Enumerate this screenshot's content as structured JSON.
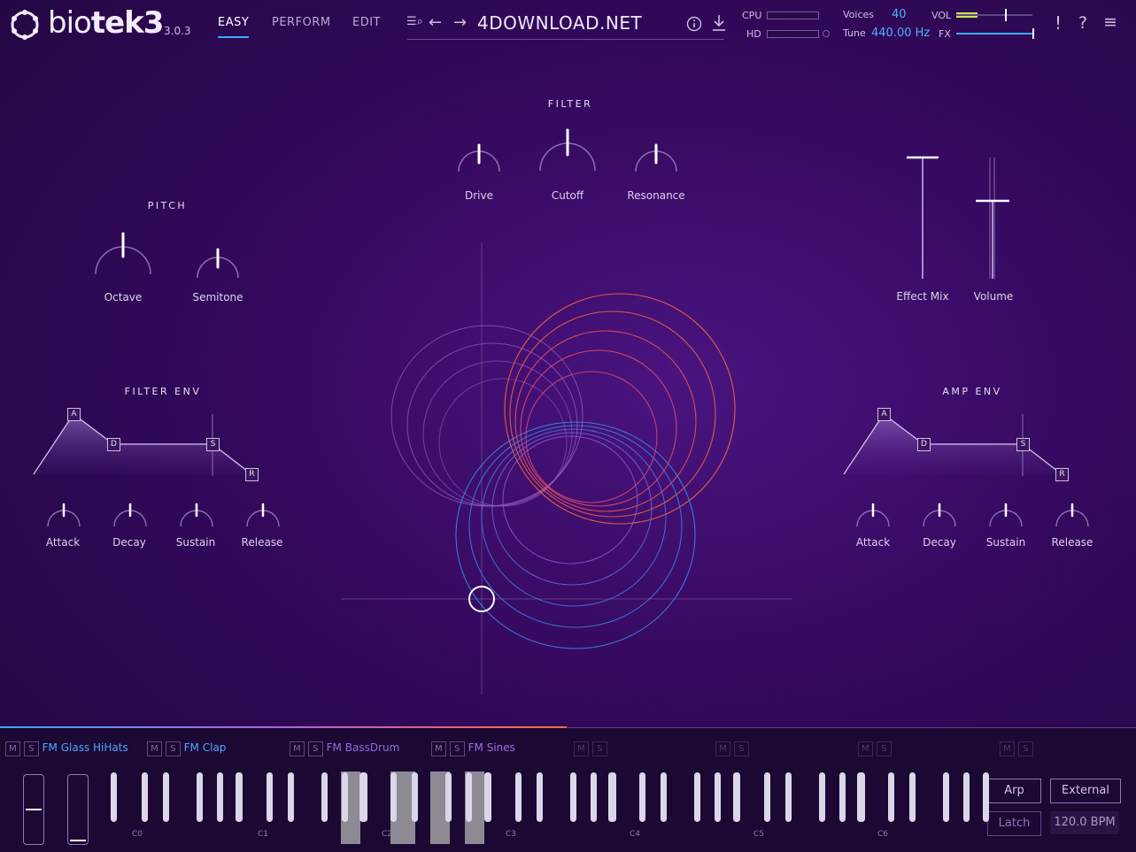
{
  "app": {
    "name_pre": "bio",
    "name_mid": "tek",
    "name_num": "3",
    "version": "3.0.3"
  },
  "tabs": [
    {
      "label": "EASY",
      "active": true
    },
    {
      "label": "PERFORM",
      "active": false
    },
    {
      "label": "EDIT",
      "active": false
    }
  ],
  "preset": {
    "name": "4DOWNLOAD.NET"
  },
  "status": {
    "cpu_label": "CPU",
    "hd_label": "HD",
    "voices_label": "Voices",
    "voices_value": "40",
    "tune_label": "Tune",
    "tune_value": "440.00 Hz",
    "vol_label": "VOL",
    "fx_label": "FX"
  },
  "filter": {
    "title": "FILTER",
    "knobs": [
      "Drive",
      "Cutoff",
      "Resonance"
    ]
  },
  "pitch": {
    "title": "PITCH",
    "knobs": [
      "Octave",
      "Semitone"
    ]
  },
  "faders": {
    "effect_mix": "Effect Mix",
    "volume": "Volume"
  },
  "filter_env": {
    "title": "FILTER ENV",
    "knobs": [
      "Attack",
      "Decay",
      "Sustain",
      "Release"
    ],
    "points": [
      "A",
      "D",
      "S",
      "R"
    ]
  },
  "amp_env": {
    "title": "AMP ENV",
    "knobs": [
      "Attack",
      "Decay",
      "Sustain",
      "Release"
    ],
    "points": [
      "A",
      "D",
      "S",
      "R"
    ]
  },
  "tracks": [
    {
      "name": "FM Glass HiHats",
      "m": "M",
      "s": "S"
    },
    {
      "name": "FM Clap",
      "m": "M",
      "s": "S"
    },
    {
      "name": "FM BassDrum",
      "m": "M",
      "s": "S"
    },
    {
      "name": "FM Sines",
      "m": "M",
      "s": "S"
    },
    {
      "name": "",
      "m": "M",
      "s": "S"
    },
    {
      "name": "",
      "m": "M",
      "s": "S"
    },
    {
      "name": "",
      "m": "M",
      "s": "S"
    },
    {
      "name": "",
      "m": "M",
      "s": "S"
    }
  ],
  "octaves": [
    "C0",
    "C1",
    "C2",
    "C3",
    "C4",
    "C5",
    "C6"
  ],
  "buttons": {
    "arp": "Arp",
    "external": "External",
    "latch": "Latch",
    "bpm": "120.0 BPM"
  },
  "colors": {
    "accent": "#3aaaff",
    "bg": "#34095e",
    "orange": "#ff6a3a"
  }
}
